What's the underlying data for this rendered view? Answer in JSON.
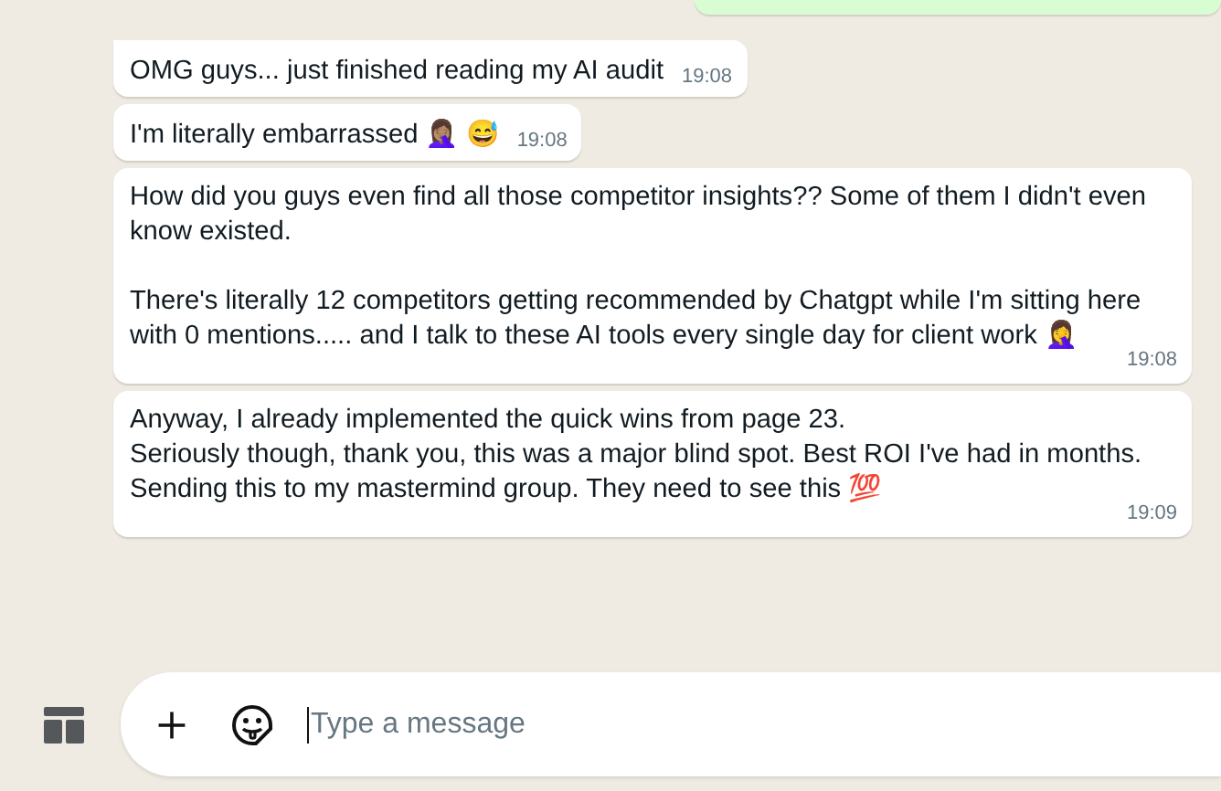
{
  "messages": [
    {
      "text": "OMG guys... just finished reading my AI audit",
      "time": "19:08",
      "kind": "inline"
    },
    {
      "text": "I'm literally embarrassed 🤦🏽‍♀️ 😅",
      "time": "19:08",
      "kind": "inline"
    },
    {
      "text": "How did you guys even find all those competitor insights?? Some of them I didn't even know existed.\n\nThere's literally 12 competitors getting recommended by Chatgpt while I'm sitting here with 0 mentions..... and I talk to these AI tools every single day for client work 🤦‍♀️",
      "time": "19:08",
      "kind": "block"
    },
    {
      "text": "Anyway, I already implemented the quick wins from page 23.\nSeriously though, thank you, this was a major blind spot. Best ROI I've had in months.\nSending this to my mastermind group. They need to see this 💯",
      "time": "19:09",
      "kind": "block"
    }
  ],
  "composer": {
    "placeholder": "Type a message"
  }
}
